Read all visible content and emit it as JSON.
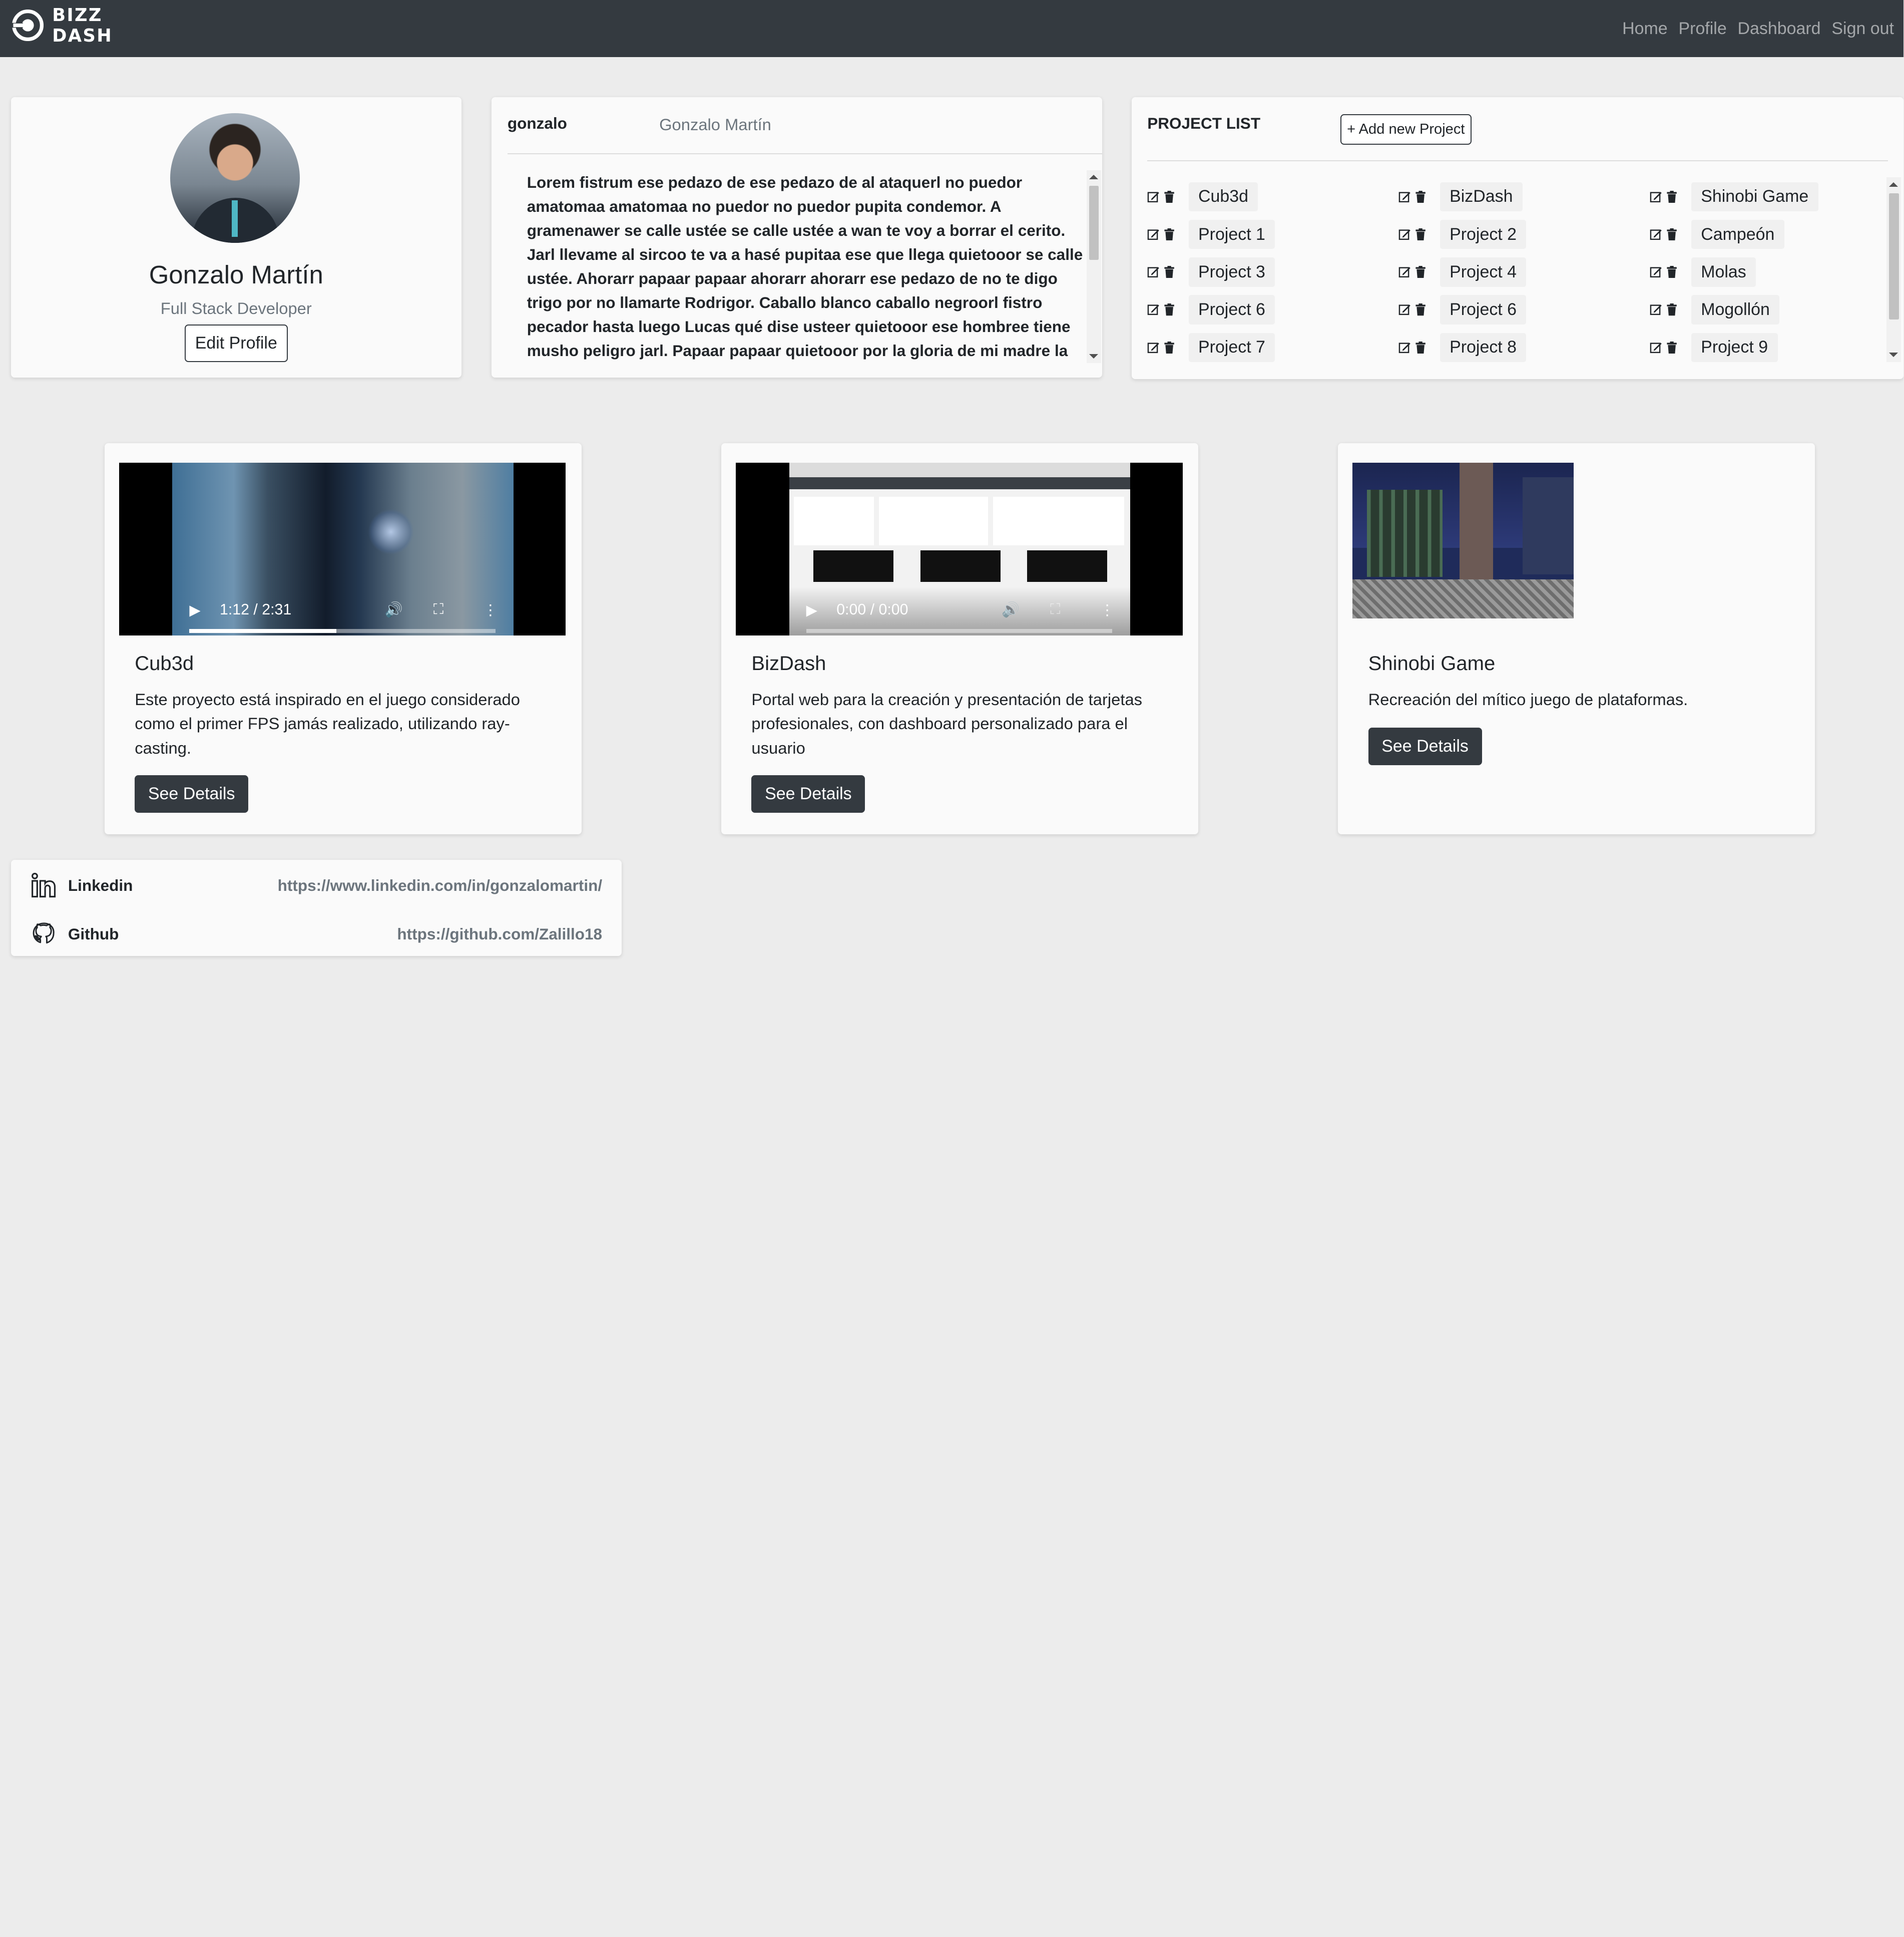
{
  "navbar": {
    "brand_line1": "BIZZ",
    "brand_line2": "DASH",
    "links": [
      "Home",
      "Profile",
      "Dashboard",
      "Sign out"
    ]
  },
  "profile": {
    "name": "Gonzalo Martín",
    "role": "Full Stack Developer",
    "edit_label": "Edit Profile"
  },
  "about": {
    "username": "gonzalo",
    "full_name": "Gonzalo Martín",
    "text": "Lorem fistrum ese pedazo de ese pedazo de al ataquerl no puedor amatomaa amatomaa no puedor no puedor pupita condemor. A gramenawer se calle ustée se calle ustée a wan te voy a borrar el cerito. Jarl llevame al sircoo te va a hasé pupitaa ese que llega quietooor se calle ustée. Ahorarr papaar papaar ahorarr ahorarr ese pedazo de no te digo trigo por no llamarte Rodrigor. Caballo blanco caballo negroorl fistro pecador hasta luego Lucas qué dise usteer quietooor ese hombree tiene musho peligro jarl. Papaar papaar quietooor por la gloria de mi madre la caidita sexuarl Un desarrollador"
  },
  "project_list": {
    "title": "PROJECT LIST",
    "add_label": "+ Add new Project",
    "items": [
      "Cub3d",
      "BizDash",
      "Shinobi Game",
      "Project 1",
      "Project 2",
      "Campeón",
      "Project 3",
      "Project 4",
      "Molas",
      "Project 6",
      "Project 6",
      "Mogollón",
      "Project 7",
      "Project 8",
      "Project 9"
    ]
  },
  "projects": [
    {
      "title": "Cub3d",
      "description": "Este proyecto está inspirado en el juego considerado como el primer FPS jamás realizado, utilizando ray-casting.",
      "button": "See Details",
      "video_time": "1:12 / 2:31",
      "progress": 0.48
    },
    {
      "title": "BizDash",
      "description": "Portal web para la creación y presentación de tarjetas profesionales, con dashboard personalizado para el usuario",
      "button": "See Details",
      "video_time": "0:00 / 0:00",
      "progress": 0
    },
    {
      "title": "Shinobi Game",
      "description": "Recreación del mítico juego de plataformas.",
      "button": "See Details"
    }
  ],
  "social": [
    {
      "label": "Linkedin",
      "url": "https://www.linkedin.com/in/gonzalomartin/",
      "icon": "linkedin-icon"
    },
    {
      "label": "Github",
      "url": "https://github.com/Zalillo18",
      "icon": "github-icon"
    }
  ],
  "colors": {
    "navbar": "#343a40",
    "background": "#ececec",
    "card": "#fafafa",
    "button_dark": "#343a40",
    "muted_text": "#6c757d"
  }
}
